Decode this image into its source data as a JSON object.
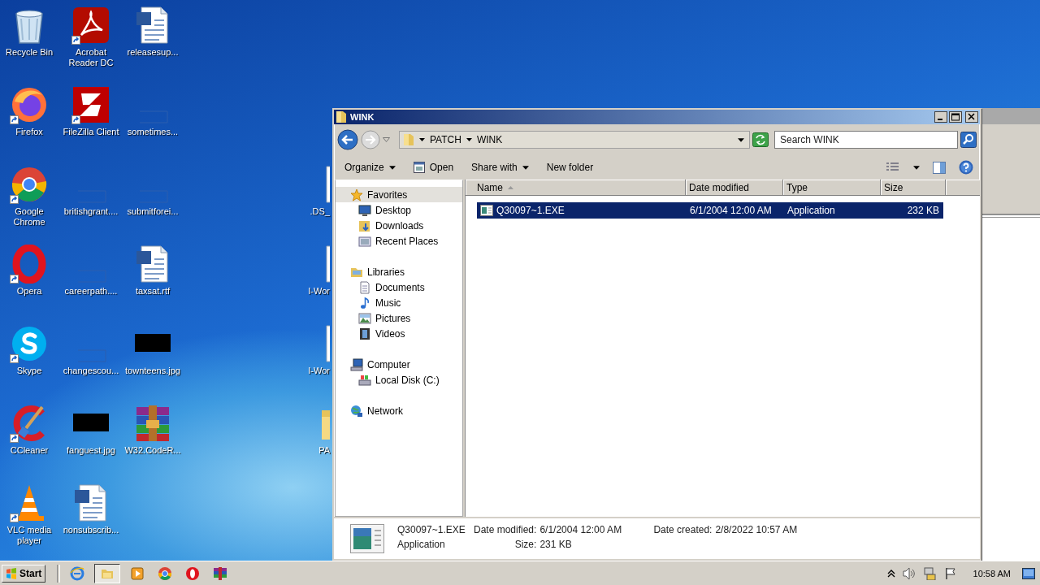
{
  "desktop_icons": [
    {
      "label": "Recycle Bin",
      "kind": "recycle",
      "shortcut": false
    },
    {
      "label": "Acrobat Reader DC",
      "kind": "acrobat",
      "shortcut": true
    },
    {
      "label": "releasesup...",
      "kind": "word",
      "shortcut": false
    },
    {
      "label": "Firefox",
      "kind": "firefox",
      "shortcut": true
    },
    {
      "label": "FileZilla Client",
      "kind": "filezilla",
      "shortcut": true
    },
    {
      "label": "sometimes...",
      "kind": "blank",
      "shortcut": false
    },
    {
      "label": "Google Chrome",
      "kind": "chrome",
      "shortcut": true
    },
    {
      "label": "britishgrant....",
      "kind": "blank",
      "shortcut": false
    },
    {
      "label": "submitforei...",
      "kind": "blank",
      "shortcut": false
    },
    {
      "label": "Opera",
      "kind": "opera",
      "shortcut": true
    },
    {
      "label": "careerpath....",
      "kind": "blank",
      "shortcut": false
    },
    {
      "label": "taxsat.rtf",
      "kind": "word",
      "shortcut": false
    },
    {
      "label": "Skype",
      "kind": "skype",
      "shortcut": true
    },
    {
      "label": "changescou...",
      "kind": "blank",
      "shortcut": false
    },
    {
      "label": "townteens.jpg",
      "kind": "dark-image",
      "shortcut": false
    },
    {
      "label": "CCleaner",
      "kind": "ccleaner",
      "shortcut": true
    },
    {
      "label": "fanguest.jpg",
      "kind": "dark-image",
      "shortcut": false
    },
    {
      "label": "W32.CodeR...",
      "kind": "winrar",
      "shortcut": false
    },
    {
      "label": "VLC media player",
      "kind": "vlc",
      "shortcut": true
    },
    {
      "label": "nonsubscrib...",
      "kind": "word",
      "shortcut": false
    }
  ],
  "partial_icons": [
    {
      "label": ".DS_",
      "kind": "file"
    },
    {
      "label": "I-Wor",
      "kind": "file"
    },
    {
      "label": "I-Wor",
      "kind": "file"
    },
    {
      "label": "PA",
      "kind": "folder"
    }
  ],
  "window": {
    "title": "WINK",
    "breadcrumb": [
      "PATCH",
      "WINK"
    ],
    "search": {
      "placeholder": "Search WINK"
    },
    "toolbar": [
      {
        "label": "Organize",
        "kind": "menu"
      },
      {
        "label": "Open",
        "kind": "icon"
      },
      {
        "label": "Share with",
        "kind": "menu"
      },
      {
        "label": "New folder",
        "kind": "plain"
      }
    ],
    "nav": [
      {
        "label": "Favorites",
        "kind": "star",
        "selected": true,
        "children": [
          {
            "label": "Desktop",
            "kind": "desktop",
            "selected": false
          },
          {
            "label": "Downloads",
            "kind": "downloads",
            "selected": false
          },
          {
            "label": "Recent Places",
            "kind": "recent",
            "selected": false
          }
        ]
      },
      {
        "label": "Libraries",
        "kind": "libraries",
        "selected": false,
        "children": [
          {
            "label": "Documents",
            "kind": "documents",
            "selected": false
          },
          {
            "label": "Music",
            "kind": "music",
            "selected": false
          },
          {
            "label": "Pictures",
            "kind": "pictures",
            "selected": false
          },
          {
            "label": "Videos",
            "kind": "videos",
            "selected": false
          }
        ]
      },
      {
        "label": "Computer",
        "kind": "computer",
        "selected": false,
        "children": [
          {
            "label": "Local Disk (C:)",
            "kind": "disk",
            "selected": false
          }
        ]
      },
      {
        "label": "Network",
        "kind": "network",
        "selected": false
      }
    ],
    "columns": [
      {
        "label": "Name",
        "sorted": true
      },
      {
        "label": "Date modified",
        "sorted": false
      },
      {
        "label": "Type",
        "sorted": false
      },
      {
        "label": "Size",
        "sorted": false
      }
    ],
    "rows": [
      {
        "name": "Q30097~1.EXE",
        "date": "6/1/2004 12:00 AM",
        "type": "Application",
        "size": "232 KB",
        "selected": true
      }
    ],
    "details": {
      "name": "Q30097~1.EXE",
      "type": "Application",
      "properties": [
        {
          "label": "Date modified:",
          "value": "6/1/2004 12:00 AM"
        },
        {
          "label": "Size:",
          "value": "231 KB"
        },
        {
          "label": "Date created:",
          "value": "2/8/2022 10:57 AM"
        }
      ]
    }
  },
  "taskbar": {
    "start": "Start",
    "apps": [
      {
        "kind": "ie",
        "active": false
      },
      {
        "kind": "explorer",
        "active": true
      },
      {
        "kind": "media",
        "active": false
      },
      {
        "kind": "chrome",
        "active": false
      },
      {
        "kind": "opera",
        "active": false
      },
      {
        "kind": "winrar",
        "active": false
      }
    ],
    "time": "10:58 AM"
  }
}
